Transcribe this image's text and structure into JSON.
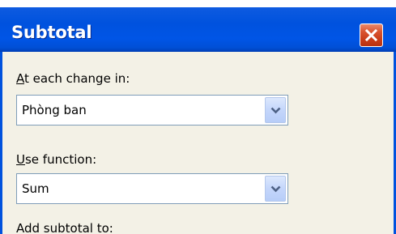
{
  "dialog": {
    "title": "Subtotal",
    "close_icon": "close-icon"
  },
  "fields": {
    "change_label_accel": "A",
    "change_label_rest": "t each change in:",
    "change_value": "Phòng ban",
    "function_label_accel": "U",
    "function_label_rest": "se function:",
    "function_value": "Sum",
    "add_to_label": "Add subtotal to:"
  },
  "colors": {
    "titlebar": "#0052de",
    "close_button": "#d9532e",
    "dialog_body": "#f3f1e6"
  }
}
